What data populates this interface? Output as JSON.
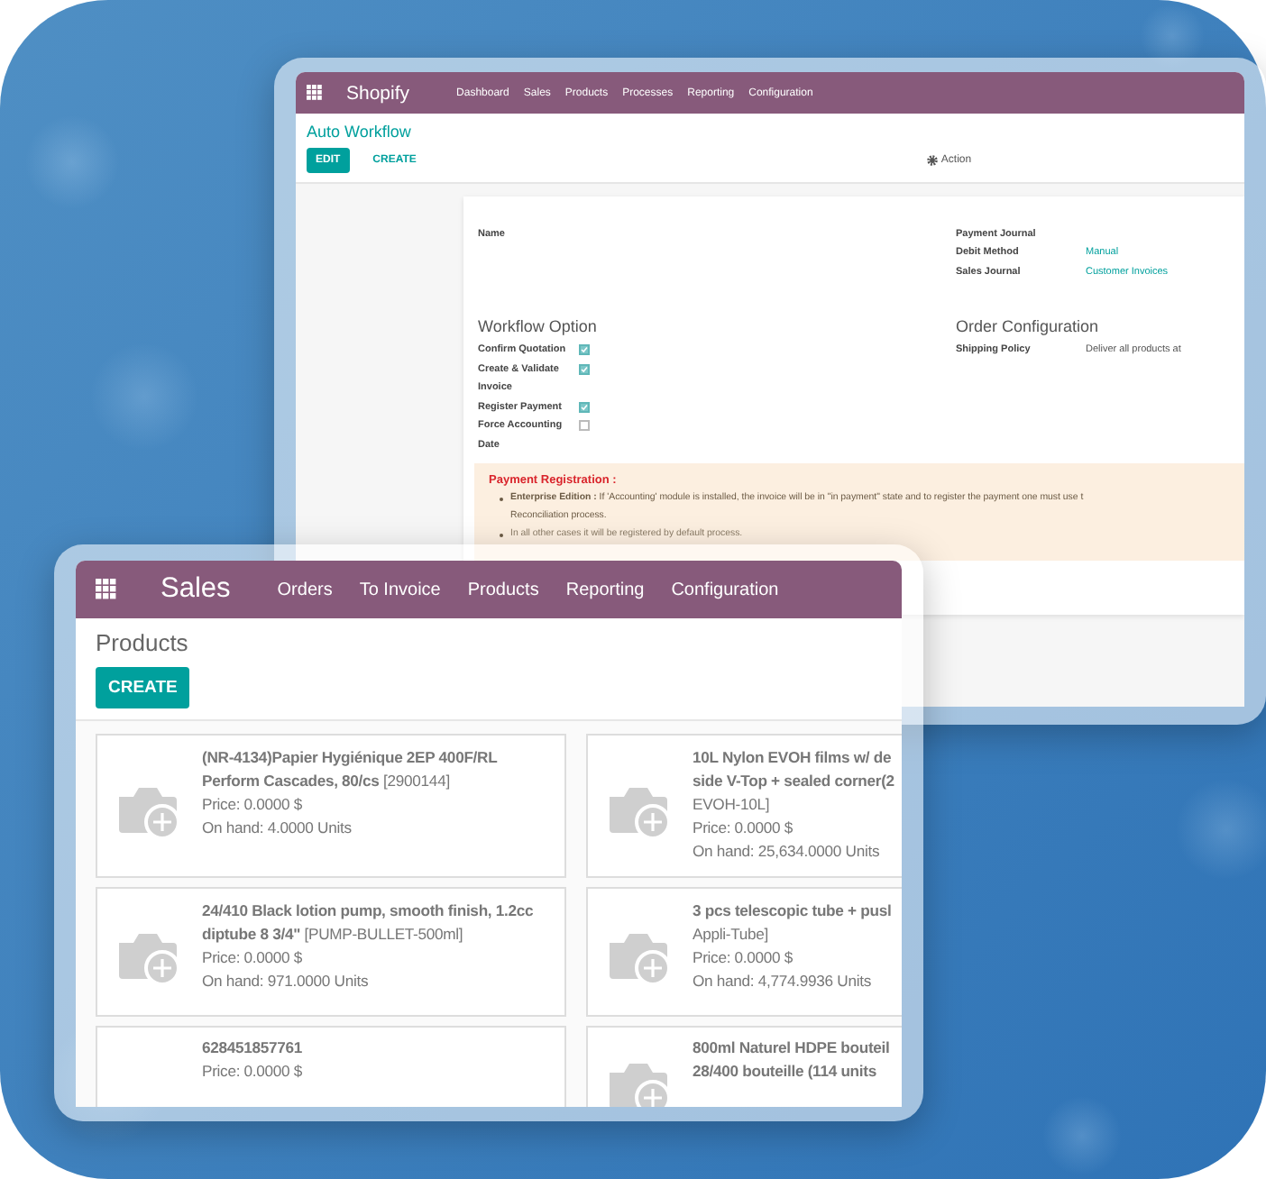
{
  "back_window": {
    "app_name": "Shopify",
    "nav": [
      "Dashboard",
      "Sales",
      "Products",
      "Processes",
      "Reporting",
      "Configuration"
    ],
    "title": "Auto Workflow",
    "buttons": [
      {
        "label": "EDIT",
        "kind": "primary"
      },
      {
        "label": "CREATE",
        "kind": "link"
      }
    ],
    "action": "Action",
    "form": {
      "left_fields": [
        {
          "label": "Name"
        }
      ],
      "right_fields": [
        {
          "label": "Payment Journal"
        },
        {
          "label": "Debit Method",
          "value": "Manual"
        },
        {
          "label": "Sales Journal",
          "value": "Customer Invoices"
        }
      ],
      "workflow_heading": "Workflow Option",
      "options": [
        {
          "label": "Confirm Quotation",
          "checked": true
        },
        {
          "label": "Create & Validate Invoice",
          "checked": true
        },
        {
          "label": "Register Payment",
          "checked": true
        },
        {
          "label": "Force Accounting Date",
          "checked": false
        }
      ],
      "order_heading": "Order Configuration",
      "order_fields": [
        {
          "label": "Shipping Policy",
          "value": "Deliver all products at"
        }
      ],
      "alert": {
        "title": "Payment Registration :",
        "bullets": [
          {
            "lines": [
              "**Enterprise Edition :** If 'Accounting' module is installed, the invoice will be in \"in payment\" state and to register the payment one must use t",
              "Reconciliation process."
            ]
          },
          {
            "lines": [
              "In all other cases it will be registered by default process."
            ]
          }
        ]
      }
    }
  },
  "front_window": {
    "app_name": "Sales",
    "nav": [
      "Orders",
      "To Invoice",
      "Products",
      "Reporting",
      "Configuration"
    ],
    "title": "Products",
    "create": "CREATE",
    "cards": [
      {
        "title_lines": [
          "**(NR-4134)Papier Hygiénique 2EP 400F/RL**",
          "**Perform Cascades, 80/cs** [2900144]"
        ],
        "price": "Price: 0.0000 $",
        "on_hand": "On hand: 4.0000 Units",
        "has_image": true
      },
      {
        "title_lines": [
          "**10L Nylon EVOH films w/ de**",
          "**side V-Top + sealed corner(2**",
          "EVOH-10L]"
        ],
        "price": "Price: 0.0000 $",
        "on_hand": "On hand: 25,634.0000 Units",
        "has_image": true
      },
      {
        "title_lines": [
          "**24/410 Black lotion pump, smooth finish, 1.2cc**",
          "**diptube 8 3/4\"** [PUMP-BULLET-500ml]"
        ],
        "price": "Price: 0.0000 $",
        "on_hand": "On hand: 971.0000 Units",
        "has_image": true
      },
      {
        "title_lines": [
          "**3 pcs telescopic tube + pusl**",
          "Appli-Tube]"
        ],
        "price": "Price: 0.0000 $",
        "on_hand": "On hand: 4,774.9936 Units",
        "has_image": true
      },
      {
        "title_lines": [
          "**628451857761**"
        ],
        "price": "Price: 0.0000 $",
        "has_image": false
      },
      {
        "title_lines": [
          "**800ml Naturel HDPE bouteil**",
          "**28/400 bouteille (114 units**"
        ],
        "has_image": true
      }
    ]
  }
}
